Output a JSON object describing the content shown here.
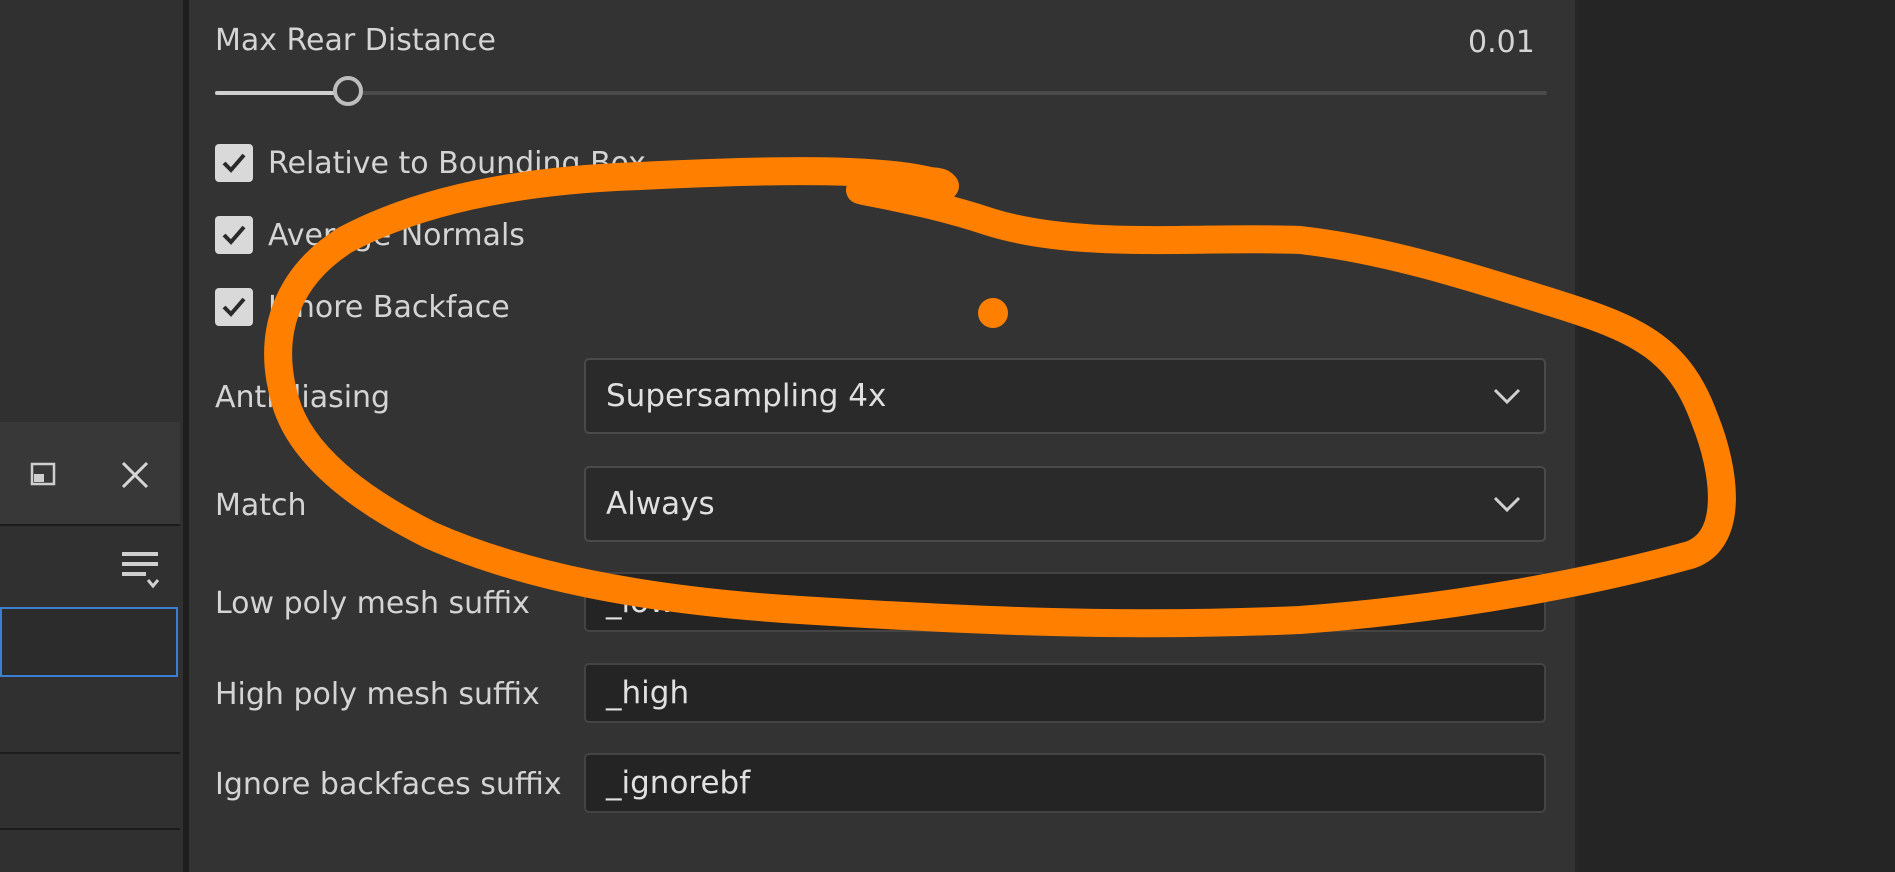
{
  "settings": {
    "max_rear_distance": {
      "label": "Max Rear Distance",
      "value": "0.01",
      "slider_fraction": 0.1
    },
    "checkboxes": [
      {
        "label": "Relative to Bounding Box",
        "checked": true
      },
      {
        "label": "Average Normals",
        "checked": true
      },
      {
        "label": "Ignore Backface",
        "checked": true
      }
    ],
    "antialiasing": {
      "label": "Antialiasing",
      "value": "Supersampling 4x"
    },
    "match": {
      "label": "Match",
      "value": "Always"
    },
    "low_poly_suffix": {
      "label": "Low poly mesh suffix",
      "value": "_low"
    },
    "high_poly_suffix": {
      "label": "High poly mesh suffix",
      "value": "_high"
    },
    "ignore_backfaces_suffix": {
      "label": "Ignore backfaces suffix",
      "value": "_ignorebf"
    }
  },
  "icons": {
    "float": "float-window-icon",
    "close": "close-icon",
    "menu": "list-options-icon",
    "dropdown": "chevron-down-icon",
    "check": "checkmark-icon"
  },
  "colors": {
    "annotation": "#ff8000",
    "selection_border": "#3c7fd2"
  }
}
